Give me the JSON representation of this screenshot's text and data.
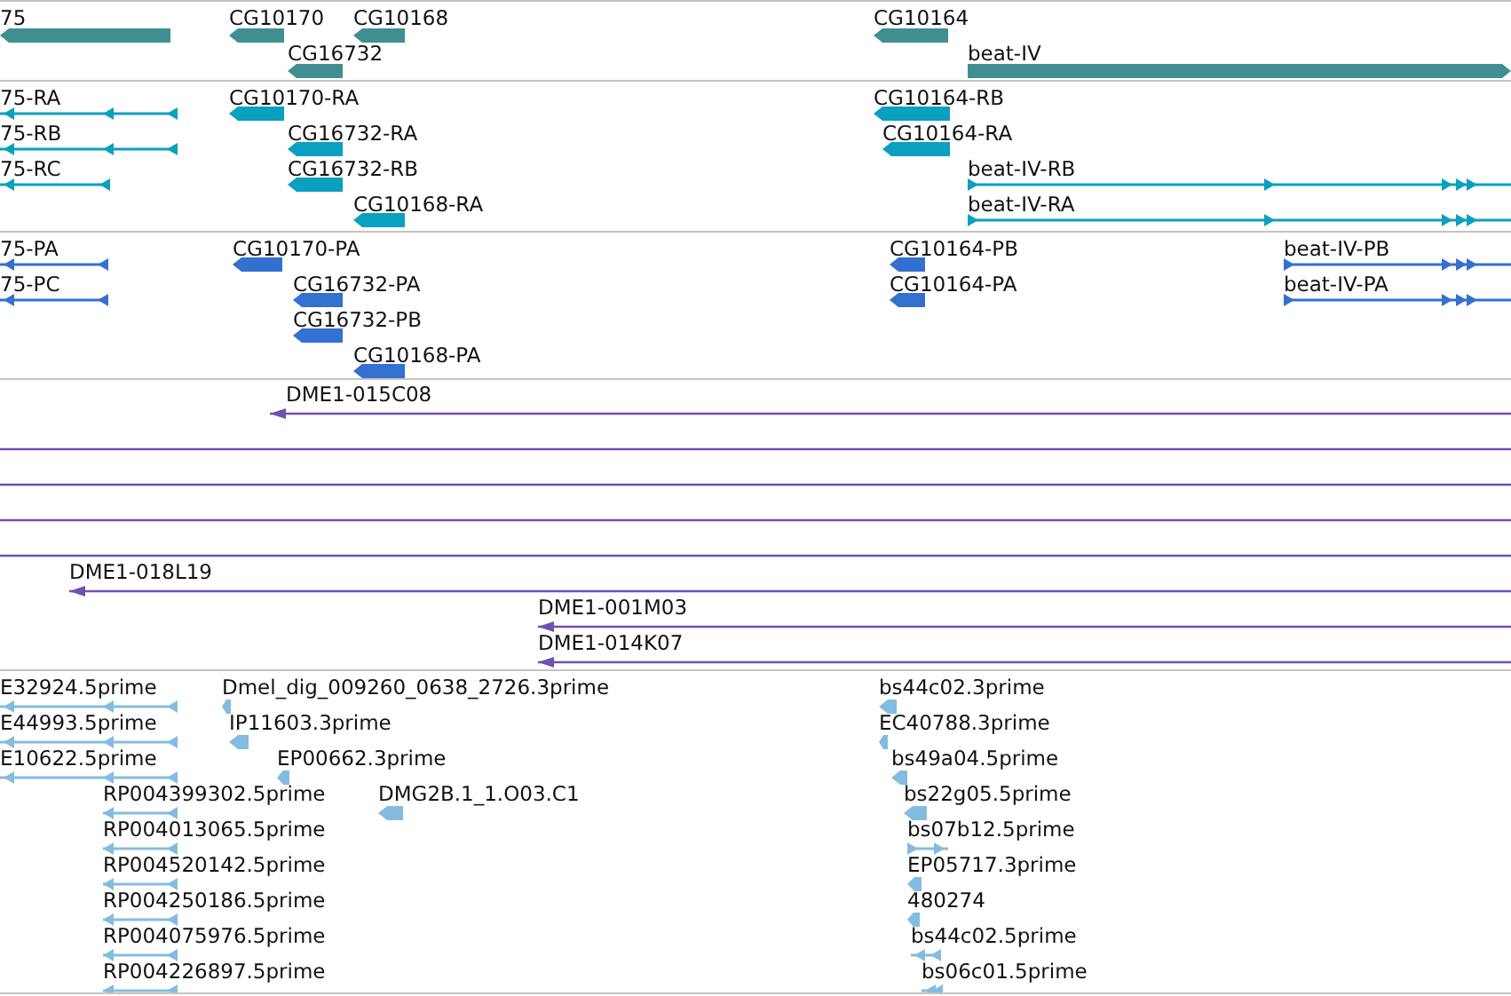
{
  "tracks": [
    {
      "color": "#3f8f90",
      "features": [
        {
          "label": "75",
          "kind": "block",
          "reverse": true
        },
        {
          "label": "CG10170",
          "kind": "block",
          "reverse": true
        },
        {
          "label": "CG10168",
          "kind": "block",
          "reverse": true
        },
        {
          "label": "CG16732",
          "kind": "block",
          "reverse": true
        },
        {
          "label": "CG10164",
          "kind": "block",
          "reverse": true
        },
        {
          "label": "beat-IV",
          "kind": "block",
          "reverse": false
        }
      ]
    },
    {
      "color": "#0aa0c0",
      "features": [
        {
          "label": "75-RA",
          "kind": "spliced",
          "reverse": true
        },
        {
          "label": "75-RB",
          "kind": "spliced",
          "reverse": true
        },
        {
          "label": "75-RC",
          "kind": "spliced",
          "reverse": true
        },
        {
          "label": "CG10170-RA",
          "kind": "block",
          "reverse": true
        },
        {
          "label": "CG16732-RA",
          "kind": "block",
          "reverse": true
        },
        {
          "label": "CG16732-RB",
          "kind": "block",
          "reverse": true
        },
        {
          "label": "CG10168-RA",
          "kind": "block",
          "reverse": true
        },
        {
          "label": "CG10164-RB",
          "kind": "block",
          "reverse": true
        },
        {
          "label": "CG10164-RA",
          "kind": "block",
          "reverse": true
        },
        {
          "label": "beat-IV-RB",
          "kind": "spliced",
          "reverse": false
        },
        {
          "label": "beat-IV-RA",
          "kind": "spliced",
          "reverse": false
        }
      ]
    },
    {
      "color": "#3370d0",
      "features": [
        {
          "label": "75-PA",
          "kind": "spliced",
          "reverse": true
        },
        {
          "label": "75-PC",
          "kind": "spliced",
          "reverse": true
        },
        {
          "label": "CG10170-PA",
          "kind": "block",
          "reverse": true
        },
        {
          "label": "CG16732-PA",
          "kind": "block",
          "reverse": true
        },
        {
          "label": "CG16732-PB",
          "kind": "block",
          "reverse": true
        },
        {
          "label": "CG10168-PA",
          "kind": "block",
          "reverse": true
        },
        {
          "label": "CG10164-PB",
          "kind": "block",
          "reverse": true
        },
        {
          "label": "CG10164-PA",
          "kind": "block",
          "reverse": true
        },
        {
          "label": "beat-IV-PB",
          "kind": "spliced",
          "reverse": false
        },
        {
          "label": "beat-IV-PA",
          "kind": "spliced",
          "reverse": false
        }
      ]
    },
    {
      "color": "#7050b0",
      "features": [
        {
          "label": "DME1-015C08",
          "kind": "span",
          "reverse": true
        },
        {
          "kind": "span"
        },
        {
          "kind": "span"
        },
        {
          "kind": "span"
        },
        {
          "kind": "span"
        },
        {
          "label": "DME1-018L19",
          "kind": "span",
          "reverse": true
        },
        {
          "label": "DME1-001M03",
          "kind": "span",
          "reverse": true
        },
        {
          "label": "DME1-014K07",
          "kind": "span",
          "reverse": true
        }
      ]
    },
    {
      "color": "#84bce0",
      "features": [
        {
          "label": "E32924.5prime",
          "kind": "spliced",
          "reverse": true
        },
        {
          "label": "E44993.5prime",
          "kind": "spliced",
          "reverse": true
        },
        {
          "label": "E10622.5prime",
          "kind": "spliced",
          "reverse": true
        },
        {
          "label": "RP004399302.5prime",
          "kind": "spliced",
          "reverse": true
        },
        {
          "label": "RP004013065.5prime",
          "kind": "spliced",
          "reverse": true
        },
        {
          "label": "RP004520142.5prime",
          "kind": "spliced",
          "reverse": true
        },
        {
          "label": "RP004250186.5prime",
          "kind": "spliced",
          "reverse": true
        },
        {
          "label": "RP004075976.5prime",
          "kind": "spliced",
          "reverse": true
        },
        {
          "label": "RP004226897.5prime",
          "kind": "spliced",
          "reverse": true
        },
        {
          "label": "Dmel_dig_009260_0638_2726.3prime",
          "kind": "block",
          "reverse": true
        },
        {
          "label": "IP11603.3prime",
          "kind": "block",
          "reverse": true
        },
        {
          "label": "EP00662.3prime",
          "kind": "block",
          "reverse": true
        },
        {
          "label": "DMG2B.1_1.O03.C1",
          "kind": "block",
          "reverse": true
        },
        {
          "label": "bs44c02.3prime",
          "kind": "block",
          "reverse": true
        },
        {
          "label": "EC40788.3prime",
          "kind": "block",
          "reverse": true
        },
        {
          "label": "bs49a04.5prime",
          "kind": "block",
          "reverse": true
        },
        {
          "label": "bs22g05.5prime",
          "kind": "block",
          "reverse": true
        },
        {
          "label": "bs07b12.5prime",
          "kind": "spliced",
          "reverse": false
        },
        {
          "label": "EP05717.3prime",
          "kind": "block",
          "reverse": true
        },
        {
          "label": "480274",
          "kind": "block",
          "reverse": true
        },
        {
          "label": "bs44c02.5prime",
          "kind": "spliced",
          "reverse": true
        },
        {
          "label": "bs06c01.5prime",
          "kind": "spliced",
          "reverse": true
        }
      ]
    }
  ]
}
